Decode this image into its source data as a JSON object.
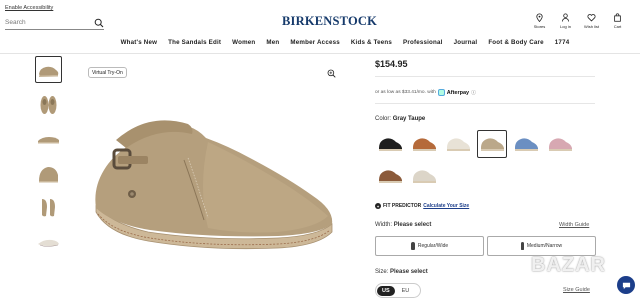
{
  "header": {
    "accessibility_link": "Enable Accessibility",
    "search_placeholder": "Search",
    "logo": "BIRKENSTOCK",
    "utilities": [
      {
        "label": "Stores",
        "icon": "location-pin-icon"
      },
      {
        "label": "Log in",
        "icon": "user-icon"
      },
      {
        "label": "Wish list",
        "icon": "heart-icon"
      },
      {
        "label": "Cart",
        "icon": "bag-icon"
      }
    ]
  },
  "nav": {
    "items": [
      "What's New",
      "The Sandals Edit",
      "Women",
      "Men",
      "Member Access",
      "Kids & Teens",
      "Professional",
      "Journal",
      "Foot & Body Care",
      "1774"
    ]
  },
  "gallery": {
    "virtual_tryon": "Virtual Try-On",
    "thumbnails": [
      "side view",
      "top pair view",
      "low side view",
      "angled front view",
      "back pair view",
      "sole view"
    ],
    "active_thumbnail": 0
  },
  "product": {
    "price": "$154.95",
    "afterpay": {
      "text": "or as low as $33.41/mo. with",
      "brand": "Afterpay",
      "info": "ⓘ"
    },
    "color": {
      "label": "Color:",
      "value": "Gray Taupe",
      "swatches": [
        {
          "name": "black",
          "color": "#1e1e1e"
        },
        {
          "name": "cognac",
          "color": "#b56a3a"
        },
        {
          "name": "eggshell",
          "color": "#e8e2d6"
        },
        {
          "name": "gray taupe",
          "color": "#bba88a"
        },
        {
          "name": "blue",
          "color": "#6b8fc2"
        },
        {
          "name": "pink",
          "color": "#d7a8b2"
        },
        {
          "name": "mocha",
          "color": "#8b5a3a"
        },
        {
          "name": "stone",
          "color": "#dcd5c8"
        }
      ],
      "active_swatch": 3
    },
    "fit_predictor": {
      "label": "FIT PREDICTOR",
      "link": "Calculate Your Size"
    },
    "width": {
      "label": "Width:",
      "prompt": "Please select",
      "guide": "Width Guide",
      "options": [
        "Regular/Wide",
        "Medium/Narrow"
      ]
    },
    "size": {
      "label": "Size:",
      "prompt": "Please select",
      "units": [
        "US",
        "EU"
      ],
      "active_unit": "US",
      "guide": "Size Guide"
    }
  },
  "overlay": {
    "watermark": "BAZAR"
  },
  "colors": {
    "brand_navy": "#163a6b",
    "link_blue": "#1c3e8a",
    "suede": "#b09a78"
  }
}
